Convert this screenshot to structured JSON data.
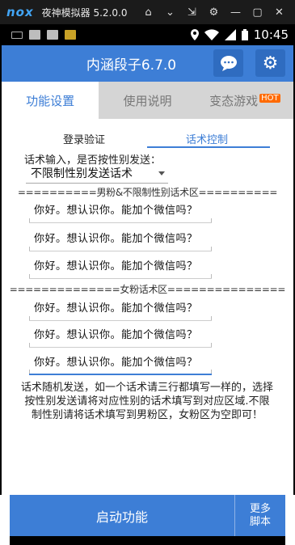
{
  "emulator": {
    "logo": "nox",
    "title": "夜神模拟器 5.2.0.0",
    "controls": [
      "⌂",
      "⌄",
      "⇲",
      "⚙",
      "—",
      "▢",
      "✕"
    ]
  },
  "statusbar": {
    "time": "10:45",
    "battery": "▮"
  },
  "header": {
    "title": "内涵段子6.7.0",
    "chat_icon": "…",
    "gear_icon": "⚙"
  },
  "tabs": [
    {
      "label": "功能设置",
      "active": true
    },
    {
      "label": "使用说明",
      "active": false
    },
    {
      "label": "变态游戏",
      "active": false,
      "badge": "HOT"
    }
  ],
  "subtabs": [
    {
      "label": "登录验证",
      "active": false
    },
    {
      "label": "话术控制",
      "active": true
    }
  ],
  "form": {
    "gender_question": "话术输入，是否按性别发送：",
    "gender_select": "不限制性别发送话术",
    "male_section": "==========男粉&不限制性别话术区==========",
    "female_section": "==============女粉话术区===============",
    "male_messages": [
      "你好。想认识你。能加个微信吗？",
      "你好。想认识你。能加个微信吗？",
      "你好。想认识你。能加个微信吗？"
    ],
    "female_messages": [
      "你好。想认识你。能加个微信吗？",
      "你好。想认识你。能加个微信吗？",
      "你好。想认识你。能加个微信吗？"
    ],
    "help_text": "话术随机发送，如一个话术请三行都填写一样的，选择按性别发送请将对应性别的话术填写到对应区域.不限制性别请将话术填写到男粉区，女粉区为空即可！"
  },
  "footer": {
    "start_label": "启动功能",
    "more_label": "更多\n脚本"
  },
  "colors": {
    "accent": "#3d7ed6",
    "hot_badge": "#ff6a00"
  }
}
